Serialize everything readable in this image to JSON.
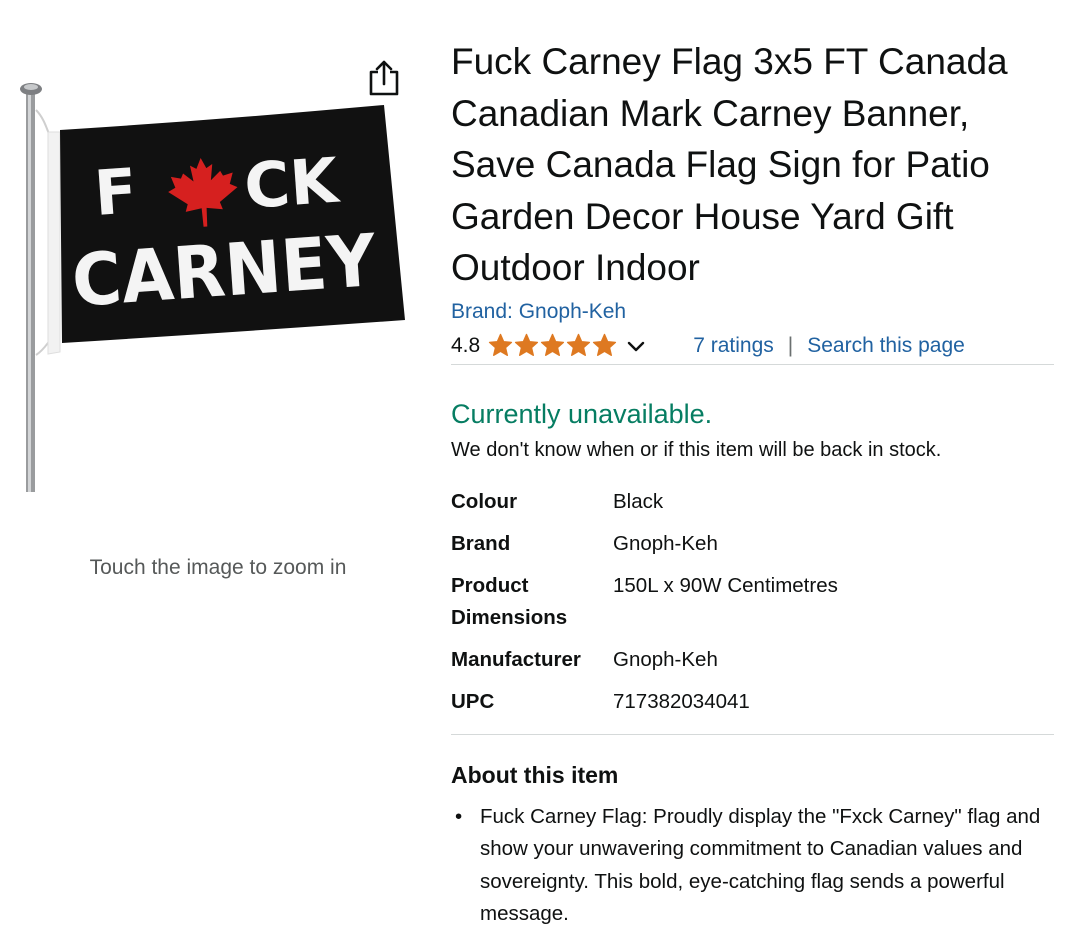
{
  "image_panel": {
    "flag_text_line1_left": "F",
    "flag_text_line1_right": "CK",
    "flag_text_line2": "CARNEY",
    "zoom_hint": "Touch the image to zoom in",
    "share_icon": "share-icon"
  },
  "product": {
    "title": "Fuck Carney Flag 3x5 FT Canada Canadian Mark Carney Banner, Save Canada Flag Sign for Patio Garden Decor House Yard Gift Outdoor Indoor",
    "brand_link": "Brand: Gnoph-Keh",
    "rating_value": "4.8",
    "star_fill": 4.8,
    "ratings_link": "7 ratings",
    "separator": "|",
    "search_link": "Search this page",
    "availability": "Currently unavailable.",
    "stock_note": "We don't know when or if this item will be back in stock."
  },
  "specs": [
    {
      "key": "Colour",
      "value": "Black"
    },
    {
      "key": "Brand",
      "value": "Gnoph-Keh"
    },
    {
      "key": "Product Dimensions",
      "value": "150L x 90W Centimetres"
    },
    {
      "key": "Manufacturer",
      "value": "Gnoph-Keh"
    },
    {
      "key": "UPC",
      "value": "717382034041"
    }
  ],
  "about": {
    "heading": "About this item",
    "bullets": [
      "Fuck Carney Flag: Proudly display the \"Fxck Carney\" flag and show your unwavering commitment to Canadian values and sovereignty. This bold, eye-catching flag sends a powerful message."
    ]
  },
  "colors": {
    "link": "#2162a1",
    "availability": "#067d62",
    "star": "#de7921",
    "maple_leaf": "#d6201f",
    "flag_bg": "#111111"
  }
}
